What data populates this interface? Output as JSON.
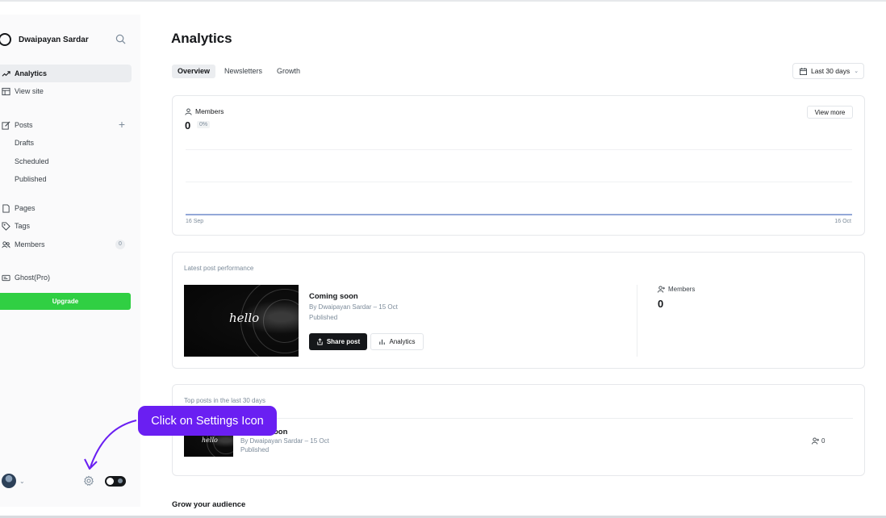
{
  "sidebar": {
    "site_name": "Dwaipayan Sardar",
    "nav": [
      {
        "label": "Analytics"
      },
      {
        "label": "View site"
      },
      {
        "label": "Posts"
      },
      {
        "label": "Drafts"
      },
      {
        "label": "Scheduled"
      },
      {
        "label": "Published"
      },
      {
        "label": "Pages"
      },
      {
        "label": "Tags"
      },
      {
        "label": "Members",
        "count": "0"
      },
      {
        "label": "Ghost(Pro)"
      }
    ],
    "upgrade_label": "Upgrade"
  },
  "main": {
    "title": "Analytics",
    "tabs": [
      "Overview",
      "Newsletters",
      "Growth"
    ],
    "date_range": "Last 30 days",
    "members_card": {
      "label": "Members",
      "value": "0",
      "change": "0%",
      "view_more": "View more",
      "x_start": "16 Sep",
      "x_end": "16 Oct"
    },
    "latest_post": {
      "section_title": "Latest post performance",
      "thumb_text": "hello",
      "title": "Coming soon",
      "byline": "By Dwaipayan Sardar – 15 Oct",
      "status": "Published",
      "share_label": "Share post",
      "analytics_label": "Analytics",
      "members_label": "Members",
      "members_value": "0"
    },
    "top_posts": {
      "section_title": "Top posts in the last 30 days",
      "row": {
        "thumb_text": "hello",
        "title_visible": "oon",
        "byline": "By Dwaipayan Sardar – 15 Oct",
        "status": "Published",
        "members": "0"
      }
    },
    "grow_title": "Grow your audience"
  },
  "overlay": {
    "tooltip_text": "Click on Settings Icon",
    "color": "#6a1ff2"
  }
}
